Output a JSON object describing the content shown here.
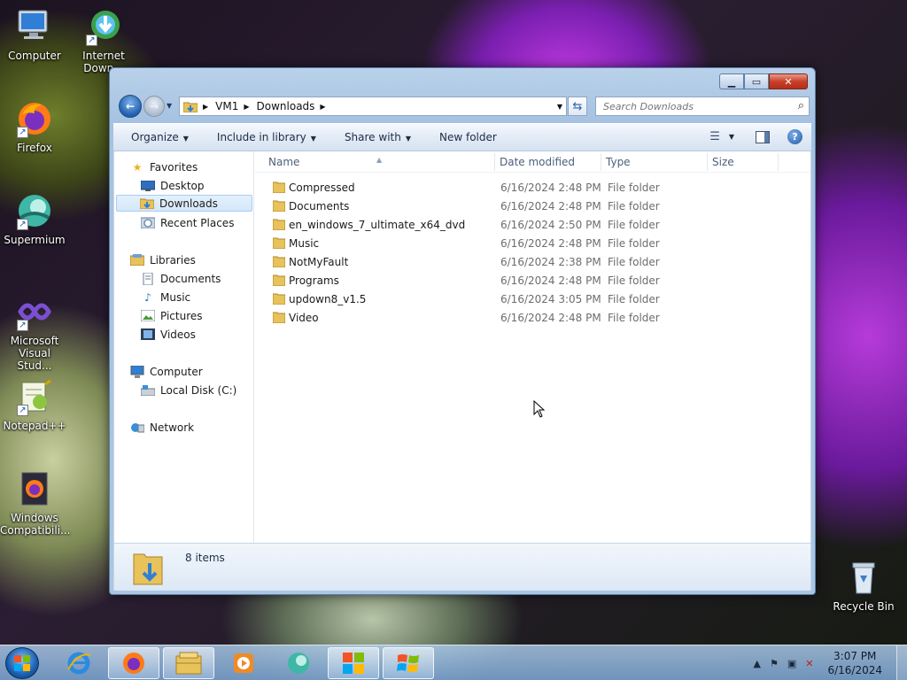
{
  "desktop": {
    "icons": [
      {
        "label": "Computer"
      },
      {
        "label": "Internet Down..."
      },
      {
        "label": "Firefox"
      },
      {
        "label": "Supermium"
      },
      {
        "label": "Microsoft Visual Stud..."
      },
      {
        "label": "Notepad++"
      },
      {
        "label": "Windows Compatibili..."
      },
      {
        "label": "Recycle Bin"
      }
    ]
  },
  "window": {
    "breadcrumbs": [
      "VM1",
      "Downloads"
    ],
    "search_placeholder": "Search Downloads",
    "toolbar": {
      "organize": "Organize",
      "include_in_library": "Include in library",
      "share_with": "Share with",
      "new_folder": "New folder"
    },
    "nav": {
      "favorites": "Favorites",
      "desktop": "Desktop",
      "downloads": "Downloads",
      "recent_places": "Recent Places",
      "libraries": "Libraries",
      "documents": "Documents",
      "music": "Music",
      "pictures": "Pictures",
      "videos": "Videos",
      "computer": "Computer",
      "local_disk": "Local Disk (C:)",
      "network": "Network"
    },
    "columns": {
      "name": "Name",
      "date_modified": "Date modified",
      "type": "Type",
      "size": "Size"
    },
    "files": [
      {
        "name": "Compressed",
        "date": "6/16/2024 2:48 PM",
        "type": "File folder"
      },
      {
        "name": "Documents",
        "date": "6/16/2024 2:48 PM",
        "type": "File folder"
      },
      {
        "name": "en_windows_7_ultimate_x64_dvd",
        "date": "6/16/2024 2:50 PM",
        "type": "File folder"
      },
      {
        "name": "Music",
        "date": "6/16/2024 2:48 PM",
        "type": "File folder"
      },
      {
        "name": "NotMyFault",
        "date": "6/16/2024 2:38 PM",
        "type": "File folder"
      },
      {
        "name": "Programs",
        "date": "6/16/2024 2:48 PM",
        "type": "File folder"
      },
      {
        "name": "updown8_v1.5",
        "date": "6/16/2024 3:05 PM",
        "type": "File folder"
      },
      {
        "name": "Video",
        "date": "6/16/2024 2:48 PM",
        "type": "File folder"
      }
    ],
    "status": {
      "item_count": "8 items"
    }
  },
  "taskbar": {
    "clock_time": "3:07 PM",
    "clock_date": "6/16/2024"
  }
}
